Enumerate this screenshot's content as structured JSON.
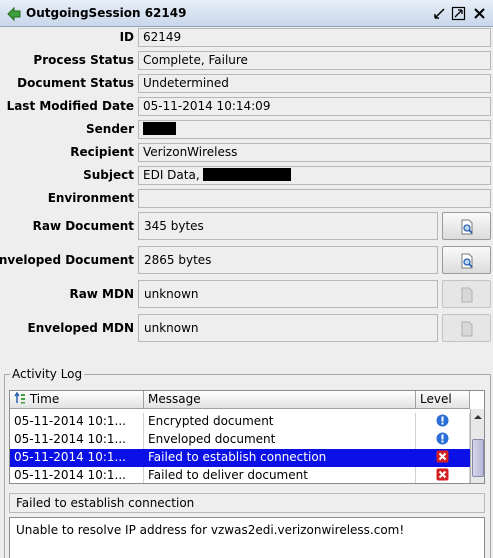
{
  "window": {
    "title": "OutgoingSession 62149"
  },
  "fields": [
    {
      "label": "ID",
      "value": "62149"
    },
    {
      "label": "Process Status",
      "value": "Complete, Failure"
    },
    {
      "label": "Document Status",
      "value": "Undetermined"
    },
    {
      "label": "Last Modified Date",
      "value": "05-11-2014 10:14:09"
    },
    {
      "label": "Sender",
      "value": ""
    },
    {
      "label": "Recipient",
      "value": "VerizonWireless"
    },
    {
      "label": "Subject",
      "value": "EDI Data,"
    },
    {
      "label": "Environment",
      "value": ""
    }
  ],
  "documents": [
    {
      "label": "Raw Document",
      "value": "345 bytes",
      "button_enabled": true,
      "icon": "view-document-icon"
    },
    {
      "label": "Enveloped Document",
      "value": "2865 bytes",
      "button_enabled": true,
      "icon": "view-document-icon"
    },
    {
      "label": "Raw MDN",
      "value": "unknown",
      "button_enabled": false,
      "icon": "document-disabled-icon"
    },
    {
      "label": "Enveloped MDN",
      "value": "unknown",
      "button_enabled": false,
      "icon": "document-disabled-icon"
    }
  ],
  "activity_log": {
    "title": "Activity Log",
    "columns": [
      "Time",
      "Message",
      "Level"
    ],
    "rows": [
      {
        "time": "05-11-2014 10:1...",
        "message": "Encrypted document",
        "level": "info",
        "selected": false
      },
      {
        "time": "05-11-2014 10:1...",
        "message": "Enveloped document",
        "level": "info",
        "selected": false
      },
      {
        "time": "05-11-2014 10:1...",
        "message": "Failed to establish connection",
        "level": "error",
        "selected": true
      },
      {
        "time": "05-11-2014 10:1...",
        "message": "Failed to deliver document",
        "level": "error",
        "selected": false
      }
    ],
    "selected_message": "Failed to establish connection",
    "detail": "Unable to resolve IP address for vzwas2edi.verizonwireless.com!"
  },
  "colors": {
    "selection": "#0a10e6",
    "info": "#2a6fd6",
    "error": "#d42020"
  }
}
